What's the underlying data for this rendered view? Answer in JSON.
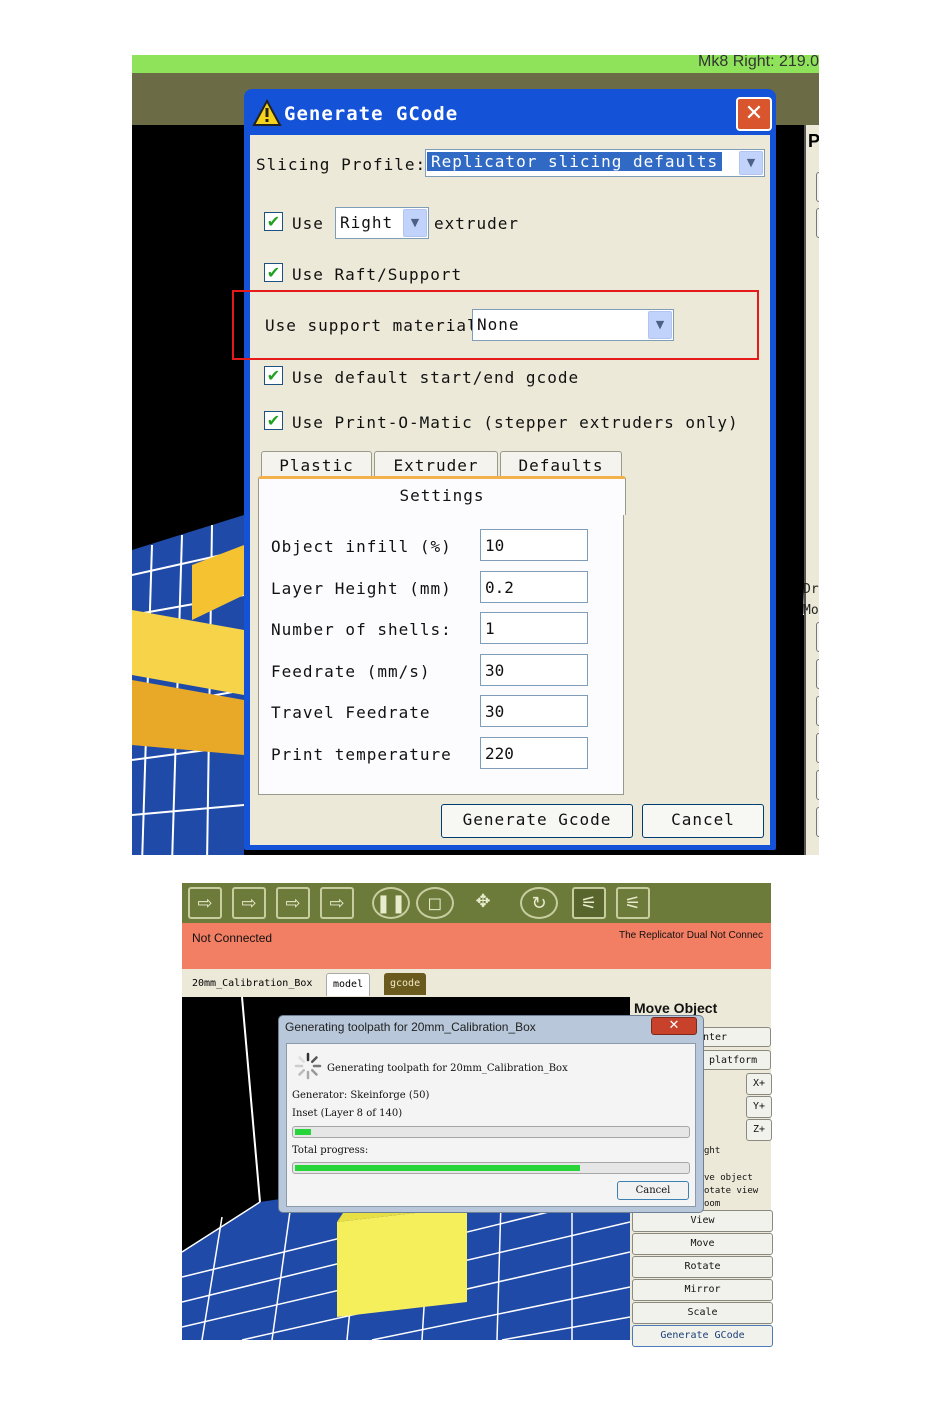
{
  "generate_gcode_dialog": {
    "title": "Generate GCode",
    "slicing_profile_label": "Slicing Profile:",
    "slicing_profile_value": "Replicator slicing defaults",
    "use_label": "Use",
    "extruder_value": "Right",
    "extruder_suffix": "extruder",
    "use_raft_support": "Use Raft/Support",
    "use_support_material_label": "Use support material",
    "support_material_value": "None",
    "use_default_gcode": "Use default start/end gcode",
    "use_print_o_matic": "Use Print-O-Matic (stepper extruders only)",
    "tabs": [
      "Plastic",
      "Extruder",
      "Defaults",
      "Settings"
    ],
    "fields": [
      {
        "label": "Object infill (%)",
        "value": "10"
      },
      {
        "label": "Layer Height (mm)",
        "value": "0.2"
      },
      {
        "label": "Number of shells:",
        "value": "1"
      },
      {
        "label": "Feedrate (mm/s)",
        "value": "30"
      },
      {
        "label": "Travel Feedrate",
        "value": "30"
      },
      {
        "label": "Print temperature",
        "value": "220"
      }
    ],
    "generate_button": "Generate Gcode",
    "cancel_button": "Cancel",
    "close_glyph": "✕"
  },
  "top_background": {
    "right_info_text": "Mk8 Right: 219.0",
    "panel_label": "P",
    "panel_label_dr": "Dr",
    "panel_label_mo": "Mo"
  },
  "bottom_app": {
    "status_left": "Not Connected",
    "status_right": "The Replicator Dual Not Connec",
    "tabs": [
      "20mm_Calibration_Box",
      "model",
      "gcode"
    ],
    "move_object_title": "Move Object",
    "right_buttons": [
      "nter",
      "platform",
      "View",
      "Move",
      "Rotate",
      "Mirror",
      "Scale",
      "Generate GCode"
    ],
    "axis_buttons": [
      "X+",
      "Y+",
      "Z+"
    ],
    "right_small_text": [
      "ght",
      "ve object",
      "otate view",
      "oom"
    ],
    "colors": {
      "toolbar": "#6c7a3a",
      "status": "#f27e63",
      "grid": "#1f4aa8",
      "box": "#f5ef5b"
    }
  },
  "progress_dialog": {
    "title": "Generating toolpath for 20mm_Calibration_Box",
    "heading": "Generating toolpath for 20mm_Calibration_Box",
    "generator": "Generator: Skeinforge (50)",
    "inset": "Inset (Layer 8 of 140)",
    "total_progress_label": "Total progress:",
    "inset_progress": 0.04,
    "total_progress": 0.73,
    "cancel_button": "Cancel",
    "close_glyph": "✕"
  }
}
